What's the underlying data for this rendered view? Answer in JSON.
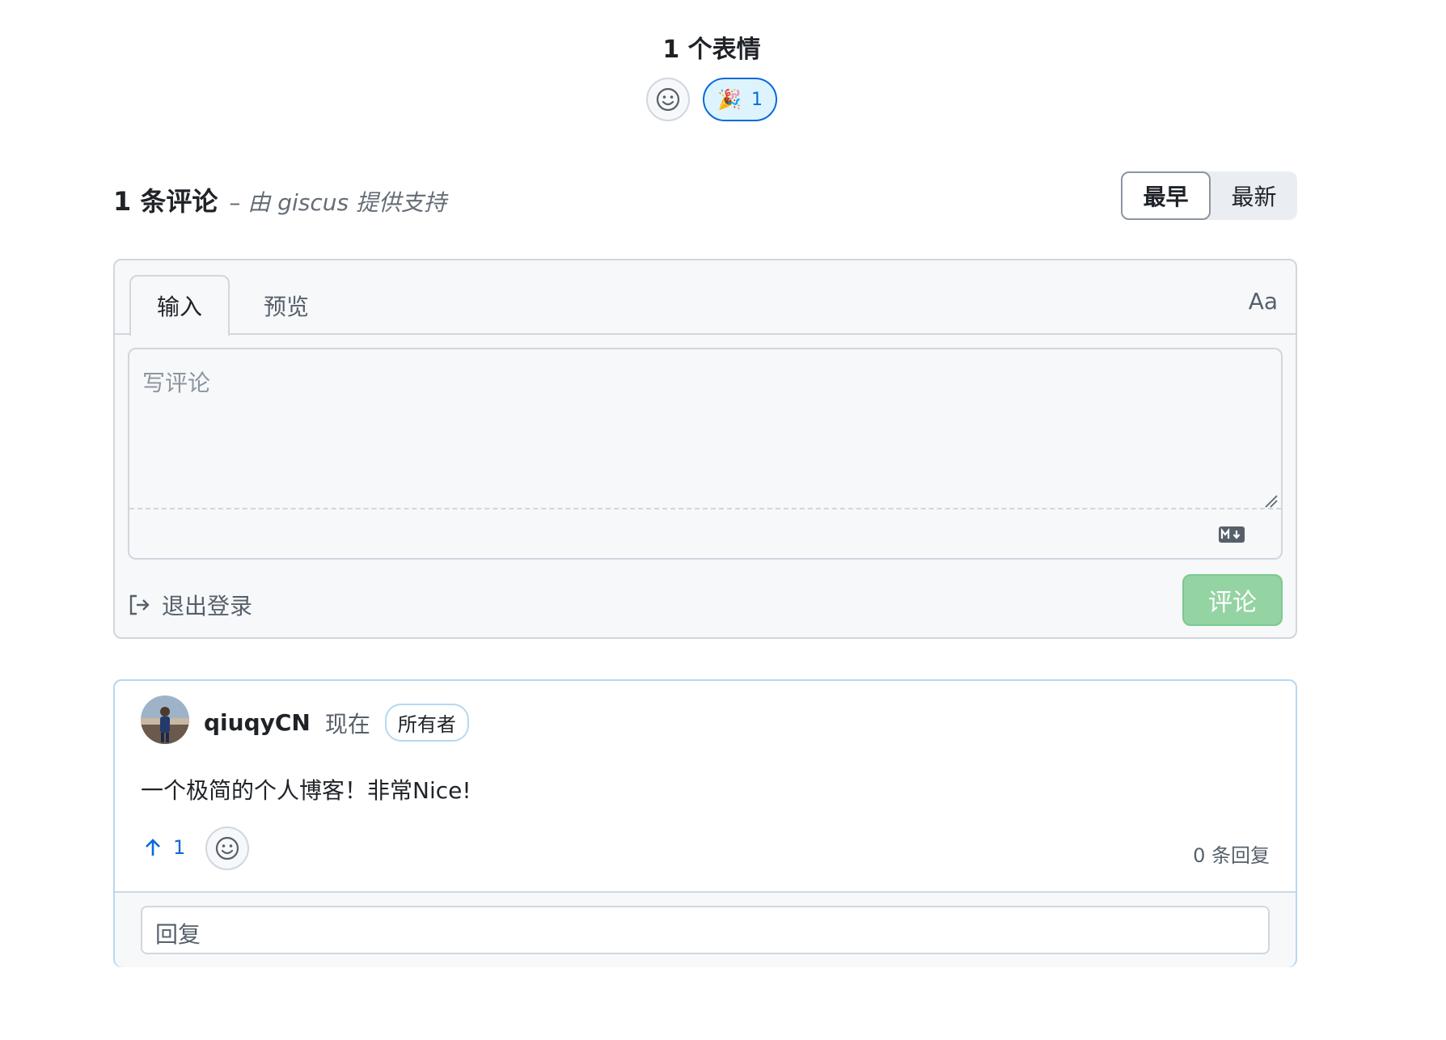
{
  "reactions": {
    "title": "1 个表情",
    "items": [
      {
        "emoji": "🎉",
        "icon": "party-popper-icon",
        "count": "1"
      }
    ]
  },
  "comments": {
    "count_label": "1 条评论",
    "powered_by": "– 由 giscus 提供支持",
    "sort": {
      "oldest": "最早",
      "newest": "最新",
      "active": "oldest"
    }
  },
  "editor": {
    "tab_write": "输入",
    "tab_preview": "预览",
    "font_toggle": "Aa",
    "placeholder": "写评论",
    "signout_label": "退出登录",
    "submit_label": "评论"
  },
  "comment": {
    "author": "qiuqyCN",
    "time": "现在",
    "badge": "所有者",
    "body": "一个极简的个人博客！非常Nice!",
    "upvotes": "1",
    "reply_count": "0 条回复",
    "reply_placeholder": "回复"
  },
  "colors": {
    "accent": "#0969da",
    "submit_disabled": "#94d3a2",
    "border": "#d0d7de",
    "card_border": "#b6d8f2"
  }
}
